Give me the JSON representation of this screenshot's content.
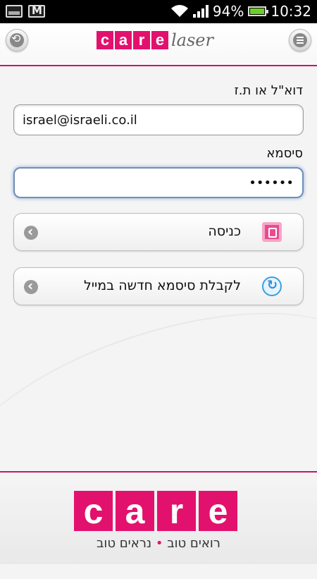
{
  "status_bar": {
    "battery": "94%",
    "time": "10:32"
  },
  "header": {
    "logo_letters": [
      "c",
      "a",
      "r",
      "e"
    ],
    "logo_suffix": "laser"
  },
  "form": {
    "email_label": "דוא\"ל או ת.ז",
    "email_value": "israel@israeli.co.il",
    "password_label": "סיסמא",
    "password_value": "••••••"
  },
  "buttons": {
    "login_label": "כניסה",
    "recover_label": "לקבלת סיסמא חדשה במייל"
  },
  "footer": {
    "logo_letters": [
      "c",
      "a",
      "r",
      "e"
    ],
    "tagline_part1": "רואים טוב",
    "tagline_dot": "•",
    "tagline_part2": "נראים טוב"
  },
  "colors": {
    "brand_pink": "#e3116e",
    "focus_blue": "#6f8fb8"
  }
}
